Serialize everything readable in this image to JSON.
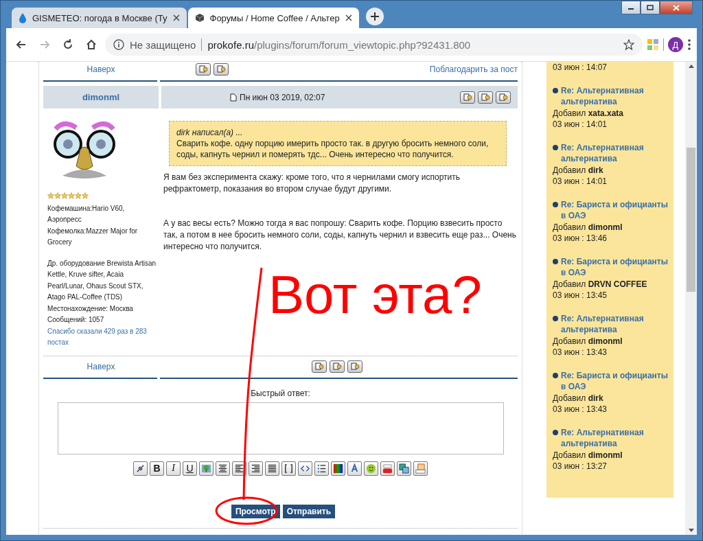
{
  "browser": {
    "tabs": [
      {
        "title": "GISMETEO: погода в Москве (Ту",
        "selected": false
      },
      {
        "title": "Форумы / Home Coffee / Альтер",
        "selected": true
      }
    ],
    "security": "Не защищено",
    "domain": "prokofe.ru",
    "path": "/plugins/forum/forum_viewtopic.php?92431.800",
    "profile_initial": "Д"
  },
  "top_nav": {
    "back_to_top": "Наверх",
    "thank": "Поблагодарить за пост"
  },
  "post": {
    "author": "dimonml",
    "date": "Пн июн 03 2019, 02:07",
    "stars": 6,
    "profile": [
      {
        "text": "Кофемашина:Hario V60, Аэропресс",
        "kind": "plain"
      },
      {
        "text": "Кофемолка:Mazzer Major for Grocery",
        "kind": "plain"
      },
      {
        "text": "Др. оборудование Brewista Artisan Kettle, Kruve sifter, Acaia Pearl/Lunar, Ohaus Scout STX, Atago PAL-Coffee (TDS)",
        "kind": "spaced"
      },
      {
        "text": "Местонахождение: Москва",
        "kind": "plain"
      },
      {
        "text": "Сообщений: 1057",
        "kind": "plain"
      },
      {
        "text": "Спасибо сказали 429 раз в 283 постах",
        "kind": "link"
      }
    ],
    "quote": {
      "header": "dirk написал(а) ...",
      "text": "Сварить кофе. одну порцию имерить просто так. в другую бросить немного соли, соды, капнуть чернил и померять тдс... Очень интересно что получится."
    },
    "paragraphs": [
      "Я вам без эксперимента скажу: кроме того, что я чернилами смогу испортить рефрактометр, показания во втором случае будут другими.",
      "А у вас весы есть? Можно тогда я вас попрошу: Сварить кофе. Порцию взвесить просто так, а потом в нее бросить немного соли, соды, капнуть чернил и взвесить еще раз... Очень интересно что получится."
    ]
  },
  "bottom_nav": {
    "back_to_top": "Наверх"
  },
  "quick_reply": {
    "label": "Быстрый ответ:",
    "toolbar": [
      {
        "kind": "link"
      },
      {
        "kind": "bold",
        "label": "B"
      },
      {
        "kind": "italic",
        "label": "I"
      },
      {
        "kind": "underline",
        "label": "U"
      },
      {
        "kind": "image"
      },
      {
        "kind": "center"
      },
      {
        "kind": "left"
      },
      {
        "kind": "right"
      },
      {
        "kind": "justify"
      },
      {
        "kind": "brackets"
      },
      {
        "kind": "code"
      },
      {
        "kind": "list"
      },
      {
        "kind": "color"
      },
      {
        "kind": "font"
      },
      {
        "kind": "smiley"
      },
      {
        "kind": "video"
      },
      {
        "kind": "picture"
      },
      {
        "kind": "html"
      }
    ],
    "buttons": [
      "Просмотр",
      "Отправить"
    ]
  },
  "sidebar": [
    {
      "time": "03 июн : 14:07"
    },
    {
      "title": "Re: Альтернативная альтернатива",
      "byline": "Добавил **xata.xata**",
      "time": "03 июн : 14:01"
    },
    {
      "title": "Re: Альтернативная альтернатива",
      "byline": "Добавил **dirk**",
      "time": "03 июн : 14:01"
    },
    {
      "title": "Re: Бариста и официанты в ОАЭ",
      "byline": "Добавил **dimonml**",
      "time": "03 июн : 13:46"
    },
    {
      "title": "Re: Бариста и официанты в ОАЭ",
      "byline": "Добавил **DRVN COFFEE**",
      "time": "03 июн : 13:45"
    },
    {
      "title": "Re: Альтернативная альтернатива",
      "byline": "Добавил **dimonml**",
      "time": "03 июн : 13:43"
    },
    {
      "title": "Re: Бариста и официанты в ОАЭ",
      "byline": "Добавил **dirk**",
      "time": "03 июн : 13:43"
    },
    {
      "title": "Re: Альтернативная альтернатива",
      "byline": "Добавил **dimonml**",
      "time": "03 июн : 13:27"
    }
  ],
  "annotation": {
    "text": "Вот эта?"
  }
}
